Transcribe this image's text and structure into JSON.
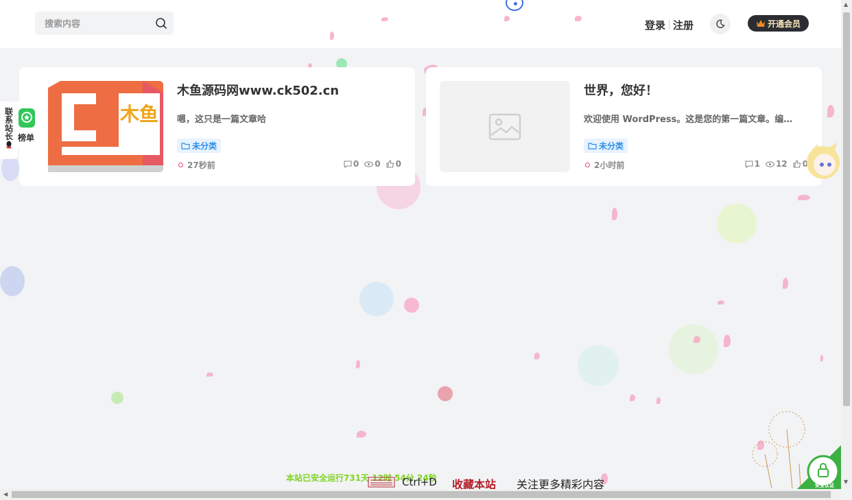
{
  "header": {
    "search_placeholder": "搜索内容",
    "login_label": "登录",
    "register_label": "注册",
    "vip_label": "开通会员"
  },
  "posts": [
    {
      "title": "木鱼源码网www.ck502.cn",
      "excerpt": "嗯，这只是一篇文章哈",
      "category": "未分类",
      "time": "27秒前",
      "comments": "0",
      "views": "0",
      "likes": "0",
      "thumb_logo_text": "木鱼"
    },
    {
      "title": "世界，您好！",
      "excerpt": "欢迎使用 WordPress。这是您的第一篇文章。编辑或删除它，然后开始写作吧！",
      "category": "未分类",
      "time": "2小时前",
      "comments": "1",
      "views": "12",
      "likes": "0"
    }
  ],
  "side": {
    "contact_label": "联系站长",
    "ranking_label": "榜单"
  },
  "footer": {
    "uptime": "本站已安全运行731天 12时 54分 24秒",
    "shortcut": "Ctrl+D",
    "bookmark": "收藏本站",
    "follow": "关注更多精彩内容",
    "safe_badge": "安全认证"
  },
  "colors": {
    "accent": "#2c8fe8",
    "vip_bg": "#2b2d33",
    "bookmark_red": "#b3202a",
    "uptime_green": "#7ed321"
  }
}
